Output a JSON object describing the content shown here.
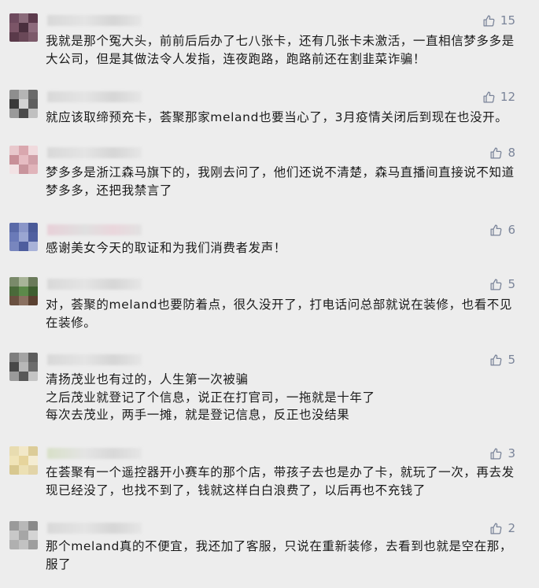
{
  "comments": [
    {
      "likes": "15",
      "text": "我就是那个冤大头，前前后后办了七八张卡，还有几张卡未激活，一直相信梦多多是大公司，但是其做法令人发指，连夜跑路，跑路前还在割韭菜诈骗！"
    },
    {
      "likes": "12",
      "text": "就应该取缔预充卡，荟聚那家meland也要当心了，3月疫情关闭后到现在也没开。"
    },
    {
      "likes": "8",
      "text": "梦多多是浙江森马旗下的，我刚去问了，他们还说不清楚，森马直播间直接说不知道梦多多，还把我禁言了"
    },
    {
      "likes": "6",
      "text": "感谢美女今天的取证和为我们消费者发声！"
    },
    {
      "likes": "5",
      "text": "对，荟聚的meland也要防着点，很久没开了，打电话问总部就说在装修，也看不见在装修。"
    },
    {
      "likes": "5",
      "text": "清扬茂业也有过的，人生第一次被骗\n之后茂业就登记了个信息，说正在打官司，一拖就是十年了\n每次去茂业，两手一摊，就是登记信息，反正也没结果"
    },
    {
      "likes": "3",
      "text": "在荟聚有一个遥控器开小赛车的那个店，带孩子去也是办了卡，就玩了一次，再去发现已经没了，也找不到了，钱就这样白白浪费了，以后再也不充钱了"
    },
    {
      "likes": "2",
      "text": "那个meland真的不便宜，我还加了客服，只说在重新装修，去看到也就是空在那，服了"
    }
  ],
  "icons": {
    "like": "thumbs-up-icon"
  },
  "colors": {
    "background": "#ededed",
    "text": "#1a1a1a",
    "like": "#7a8499"
  }
}
